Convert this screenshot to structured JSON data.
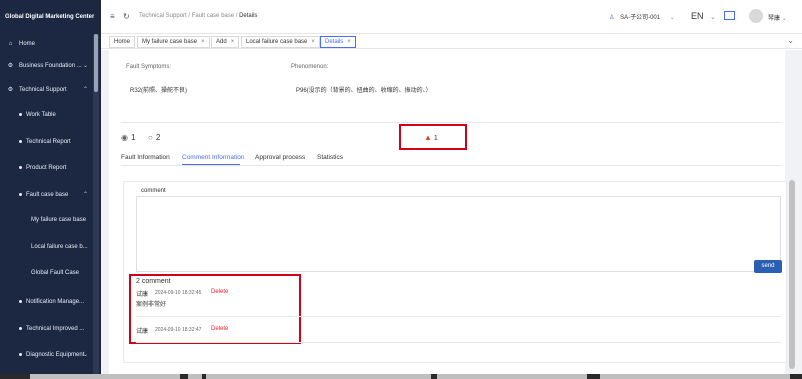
{
  "sidebar": {
    "title": "Global Digital Marketing Center",
    "items": [
      {
        "label": "Home",
        "icon": "home-icon",
        "chev": ""
      },
      {
        "label": "Business Foundation ...",
        "icon": "settings-icon",
        "chev": "⌄"
      },
      {
        "label": "Technical Support",
        "icon": "settings-icon",
        "chev": "⌃"
      },
      {
        "label": "Work Table",
        "icon": "bullet",
        "chev": ""
      },
      {
        "label": "Technical Report",
        "icon": "bullet",
        "chev": ""
      },
      {
        "label": "Product Report",
        "icon": "bullet",
        "chev": ""
      },
      {
        "label": "Fault case base",
        "icon": "bullet",
        "chev": "⌃"
      },
      {
        "label": "Notification Manage...",
        "icon": "bullet",
        "chev": ""
      },
      {
        "label": "Technical Improved ...",
        "icon": "bullet",
        "chev": ""
      },
      {
        "label": "Diagnostic Equipment",
        "icon": "bullet",
        "chev": "⌄"
      }
    ],
    "subitems": [
      "My failure case base",
      "Local failure case b...",
      "Global Fault Case"
    ]
  },
  "header": {
    "breadcrumb": [
      "Technical Support",
      "Fault case base",
      "Details"
    ],
    "user_account": "SA-子公司-001",
    "language": "EN",
    "username": "琴康"
  },
  "tabs": [
    {
      "label": "Home",
      "closable": false
    },
    {
      "label": "My failure case base",
      "closable": true
    },
    {
      "label": "Add",
      "closable": true
    },
    {
      "label": "Local failure case base",
      "closable": true
    },
    {
      "label": "Details",
      "closable": true
    }
  ],
  "details": {
    "fault_symptoms_label": "Fault Symptoms:",
    "fault_symptoms_value": "R32(前照、操舵不良)",
    "phenomenon_label": "Phenomenon:",
    "phenomenon_value": "P96(没示的（背景的、扭曲的、收缩的、振动的、）",
    "views": "1",
    "comments": "2",
    "likes": "1"
  },
  "detail_tabs": [
    "Fault Information",
    "Comment Information",
    "Approval process",
    "Statistics"
  ],
  "comment_section": {
    "label": "comment",
    "send_label": "send",
    "count_label": "2  comment",
    "entries": [
      {
        "name": "试康",
        "time": "2024-09-10 18:32:45",
        "delete_label": "Delete",
        "text": "案例非常好"
      },
      {
        "name": "试康",
        "time": "2024-09-10 18:32:47",
        "delete_label": "Delete",
        "text": ""
      }
    ]
  },
  "colors": {
    "sidebar_bg": "#1c2842",
    "accent": "#4a6cf7",
    "highlight_box": "#d0021b",
    "delete": "#f5222d"
  }
}
